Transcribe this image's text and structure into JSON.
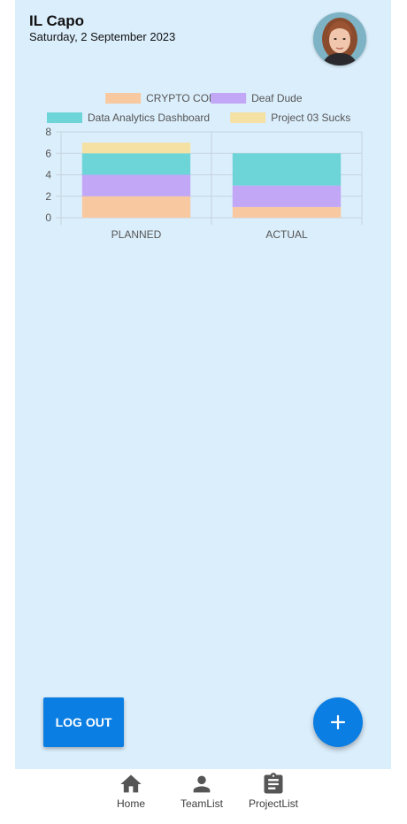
{
  "header": {
    "user_name": "IL Capo",
    "date": "Saturday, 2 September 2023"
  },
  "chart_data": {
    "type": "bar",
    "stacked": true,
    "categories": [
      "PLANNED",
      "ACTUAL"
    ],
    "series": [
      {
        "name": "CRYPTO CON",
        "values": [
          2,
          1
        ],
        "color": "#f8c9a0"
      },
      {
        "name": "Deaf Dude",
        "values": [
          2,
          2
        ],
        "color": "#c2a7f7"
      },
      {
        "name": "Data Analytics Dashboard",
        "values": [
          2,
          3
        ],
        "color": "#6dd5d8"
      },
      {
        "name": "Project 03 Sucks",
        "values": [
          1,
          0
        ],
        "color": "#f5e1a4"
      }
    ],
    "ylim": [
      0,
      8
    ],
    "yticks": [
      "0",
      "2",
      "4",
      "6",
      "8"
    ],
    "grid": true,
    "legend_position": "top"
  },
  "actions": {
    "logout_label": "LOG OUT",
    "add_icon": "plus-icon"
  },
  "nav": {
    "items": [
      {
        "label": "Home",
        "icon": "home-icon"
      },
      {
        "label": "TeamList",
        "icon": "person-icon"
      },
      {
        "label": "ProjectList",
        "icon": "clipboard-icon"
      }
    ]
  },
  "colors": {
    "panel_background": "#dbeefc",
    "accent": "#0b7ee3",
    "nav_icon": "#555555"
  }
}
